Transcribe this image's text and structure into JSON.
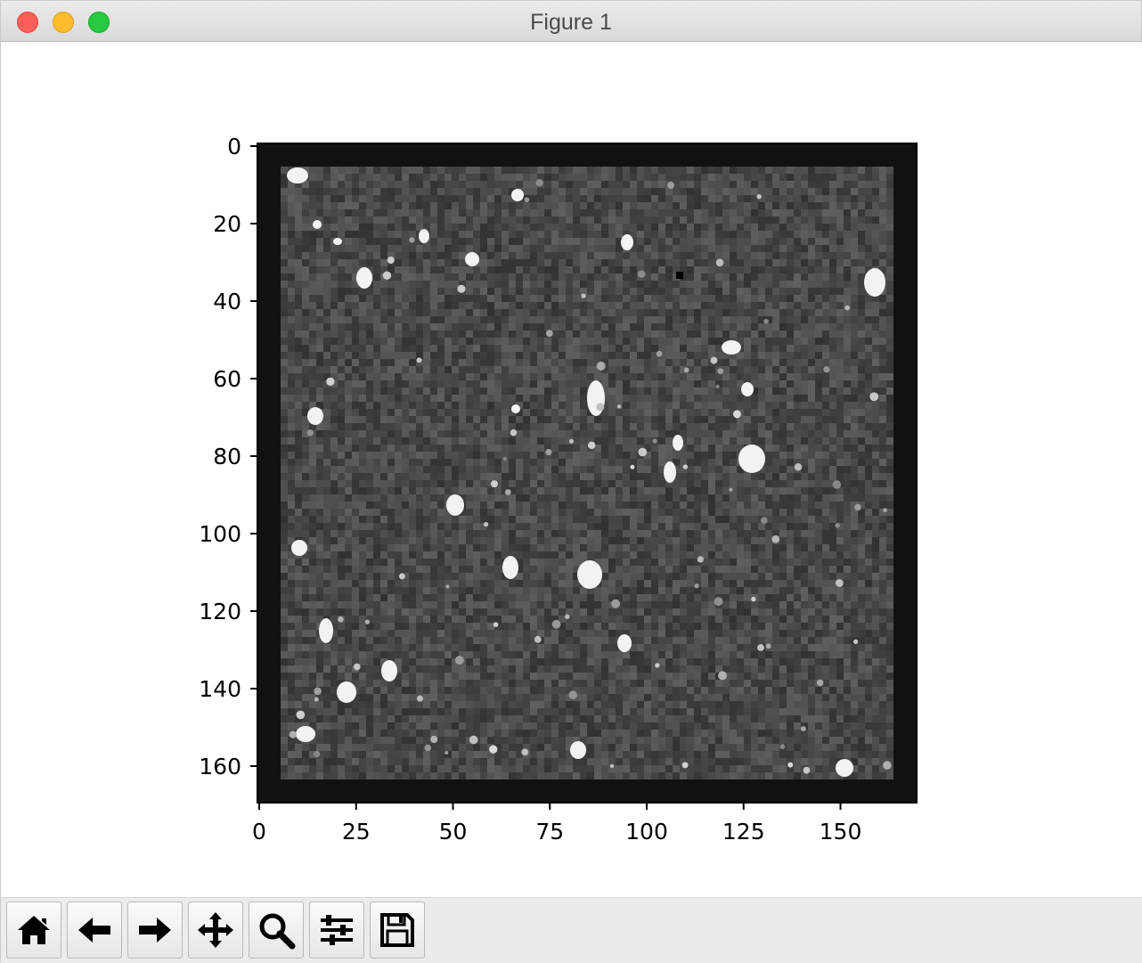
{
  "window": {
    "title": "Figure 1"
  },
  "figure": {
    "xticks": [
      "0",
      "25",
      "50",
      "75",
      "100",
      "125",
      "150"
    ],
    "yticks": [
      "0",
      "20",
      "40",
      "60",
      "80",
      "100",
      "120",
      "140",
      "160"
    ],
    "colormap": "gray",
    "frame_color": "#111111"
  },
  "toolbar": {
    "buttons": [
      {
        "icon": "home-icon",
        "name": "home-button"
      },
      {
        "icon": "back-arrow-icon",
        "name": "back-button"
      },
      {
        "icon": "forward-arrow-icon",
        "name": "forward-button"
      },
      {
        "icon": "pan-move-icon",
        "name": "pan-button"
      },
      {
        "icon": "zoom-magnifier-icon",
        "name": "zoom-button"
      },
      {
        "icon": "configure-subplots-icon",
        "name": "subplots-button"
      },
      {
        "icon": "save-floppy-icon",
        "name": "save-button"
      }
    ]
  }
}
